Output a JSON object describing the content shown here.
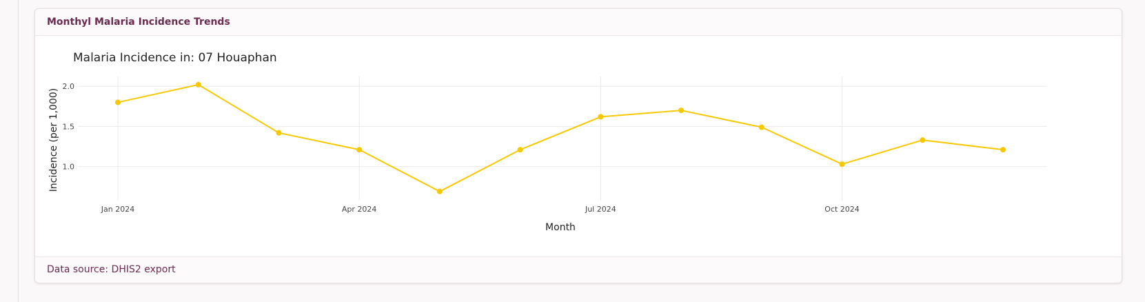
{
  "card": {
    "title": "Monthyl Malaria Incidence Trends",
    "footer": "Data source: DHIS2 export"
  },
  "chart_data": {
    "type": "line",
    "title": "Malaria Incidence in: 07 Houaphan",
    "xlabel": "Month",
    "ylabel": "Incidence (per 1,000)",
    "x": [
      "2024-01",
      "2024-02",
      "2024-03",
      "2024-04",
      "2024-05",
      "2024-06",
      "2024-07",
      "2024-08",
      "2024-09",
      "2024-10",
      "2024-11",
      "2024-12"
    ],
    "x_ticks": [
      {
        "x": "2024-01",
        "label": "Jan 2024"
      },
      {
        "x": "2024-04",
        "label": "Apr 2024"
      },
      {
        "x": "2024-07",
        "label": "Jul 2024"
      },
      {
        "x": "2024-10",
        "label": "Oct 2024"
      }
    ],
    "y_ticks": [
      {
        "value": 1.0,
        "label": "1.0"
      },
      {
        "value": 1.5,
        "label": "1.5"
      },
      {
        "value": 2.0,
        "label": "2.0"
      }
    ],
    "series": [
      {
        "values": [
          1.8,
          2.02,
          1.42,
          1.21,
          0.69,
          1.21,
          1.62,
          1.7,
          1.49,
          1.03,
          1.33,
          1.21
        ],
        "color": "#f5c800"
      }
    ],
    "ylim": [
      0.61,
      2.13
    ],
    "grid": true,
    "legend": "none"
  }
}
